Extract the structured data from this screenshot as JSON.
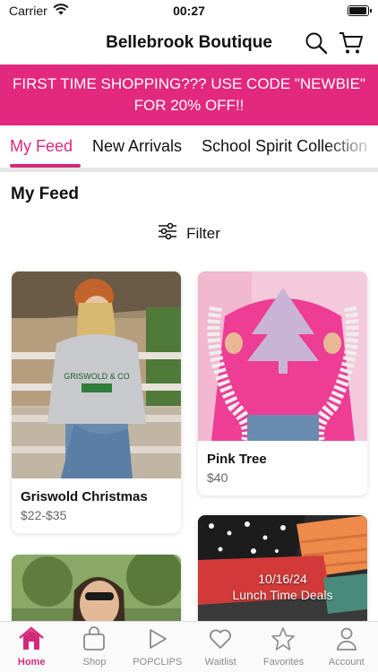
{
  "status": {
    "carrier": "Carrier",
    "time": "00:27",
    "battery_level": 0.95
  },
  "app": {
    "title": "Bellebrook Boutique"
  },
  "promo": {
    "text": "FIRST TIME SHOPPING??? USE CODE \"NEWBIE\" FOR 20% OFF!!"
  },
  "tabs": [
    {
      "label": "My Feed",
      "active": true
    },
    {
      "label": "New Arrivals"
    },
    {
      "label": "School Spirit Collection"
    }
  ],
  "feed": {
    "title": "My Feed",
    "filter_label": "Filter"
  },
  "products": [
    {
      "name": "Griswold Christmas",
      "price": "$22-$35"
    },
    {
      "name": "Pink Tree",
      "price": "$40"
    },
    {
      "name": "",
      "price": ""
    },
    {
      "name": "",
      "price": "",
      "overlay_date": "10/16/24",
      "overlay_caption": "Lunch Time Deals"
    }
  ],
  "bottom_nav": [
    {
      "label": "Home",
      "icon": "home-icon",
      "active": true
    },
    {
      "label": "Shop",
      "icon": "bag-icon"
    },
    {
      "label": "POPCLIPS",
      "icon": "play-icon"
    },
    {
      "label": "Waitlist",
      "icon": "heart-icon"
    },
    {
      "label": "Favorites",
      "icon": "star-icon"
    },
    {
      "label": "Account",
      "icon": "person-icon"
    }
  ],
  "colors": {
    "accent": "#e2287f",
    "tab_active": "#d42a7c"
  }
}
